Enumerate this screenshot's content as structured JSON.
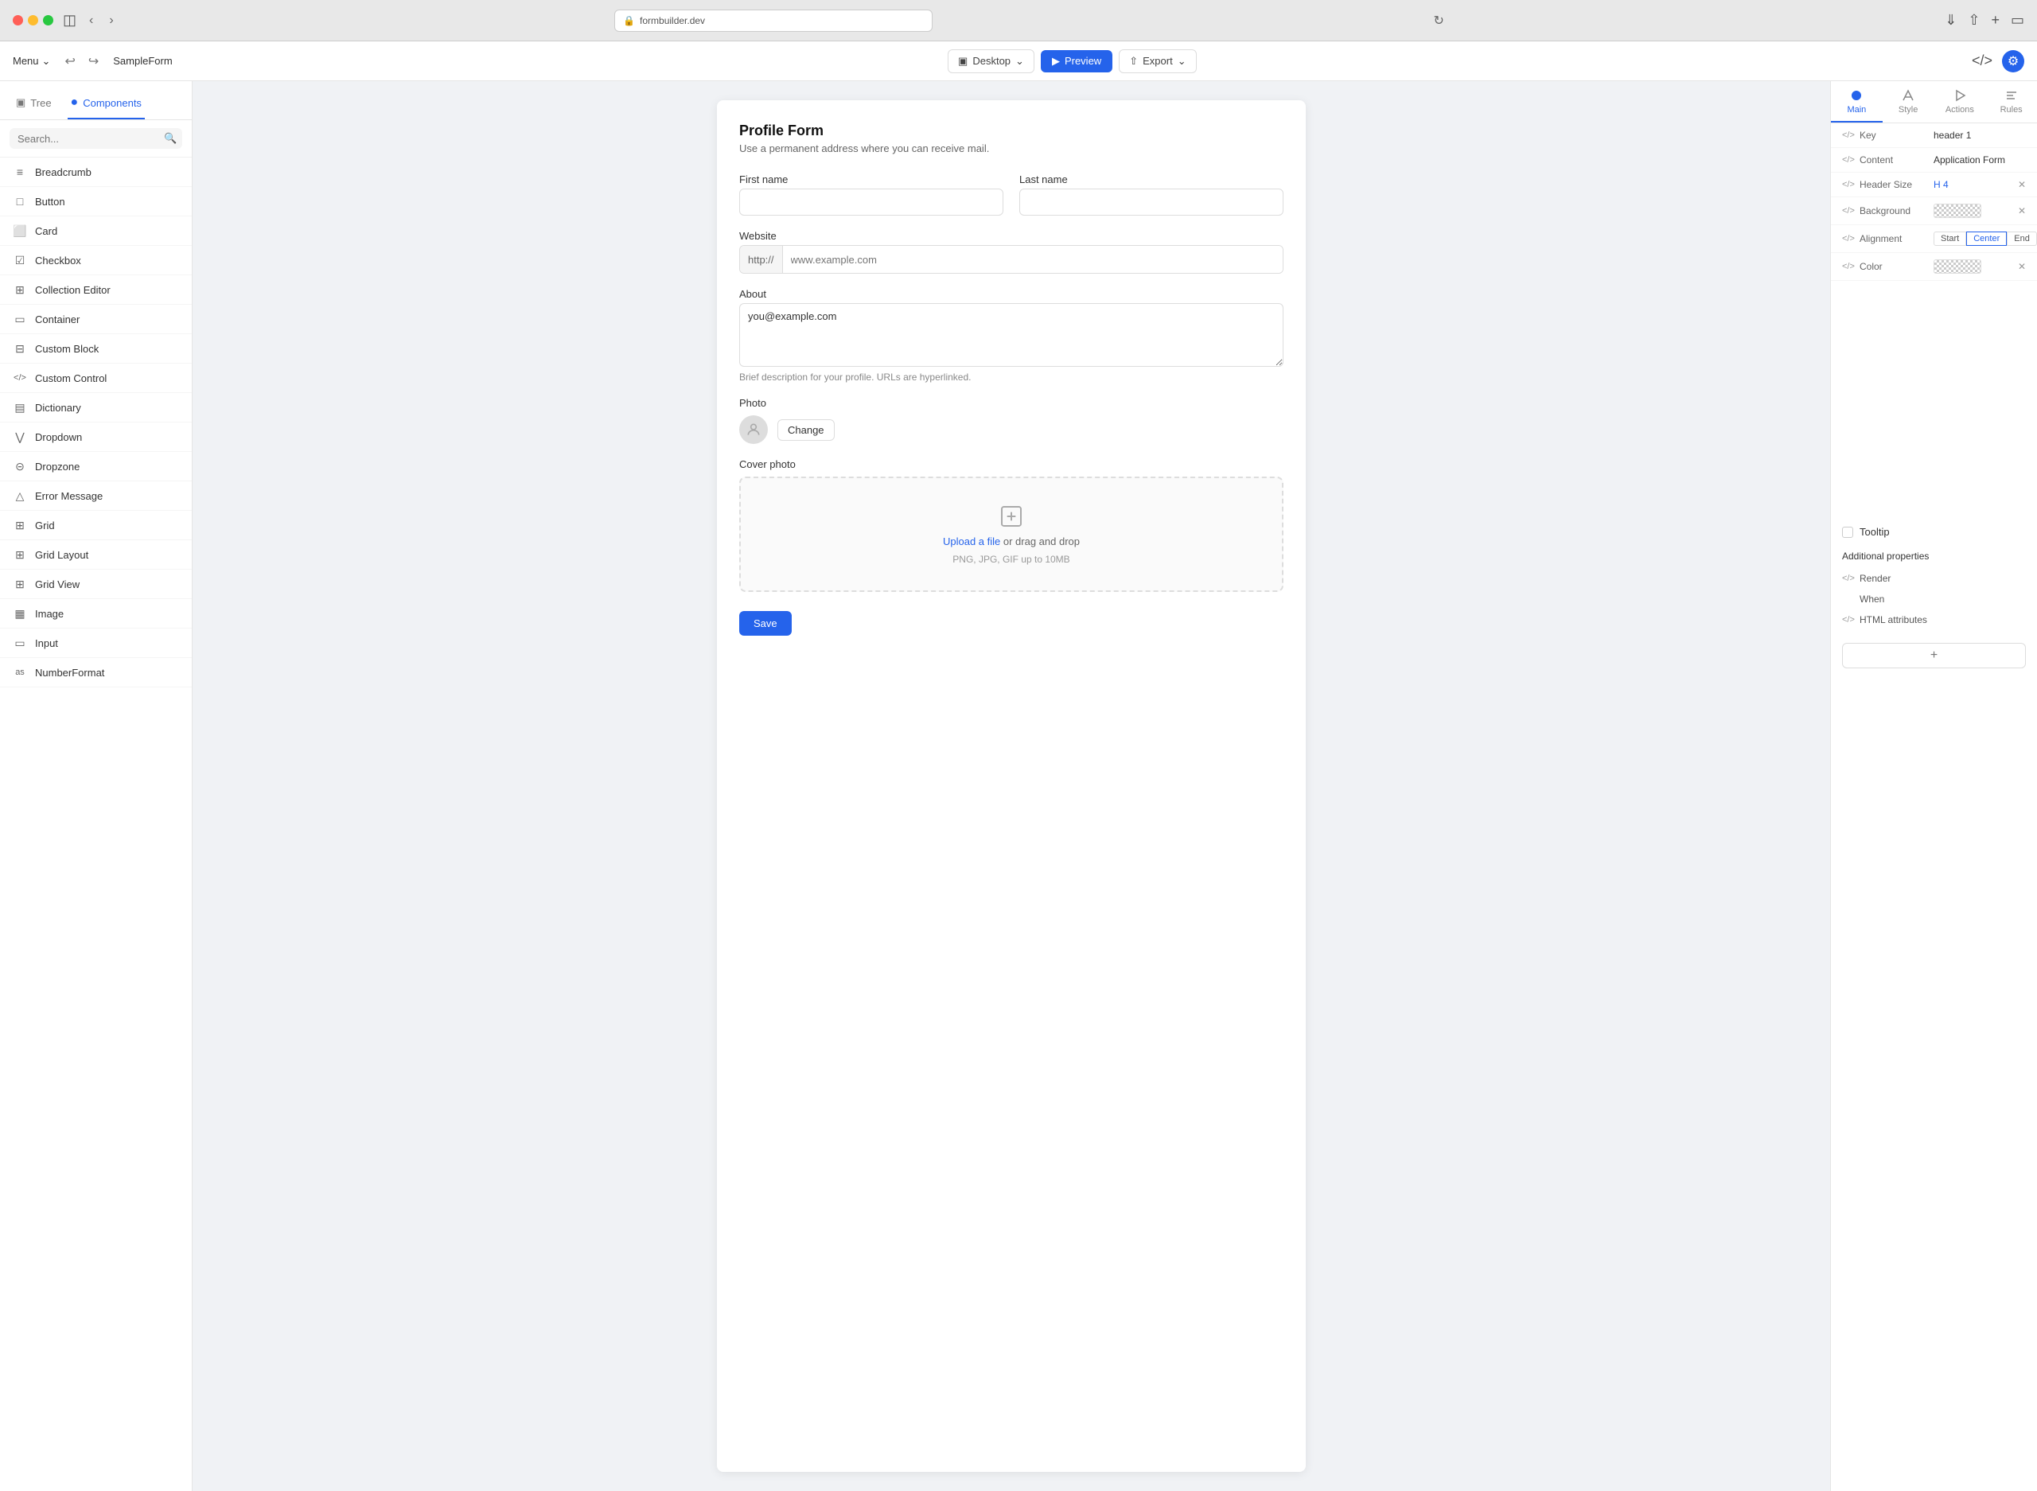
{
  "browser": {
    "url": "formbuilder.dev",
    "lock_icon": "🔒",
    "reload_icon": "↻"
  },
  "toolbar": {
    "menu_label": "Menu",
    "form_name": "SampleForm",
    "desktop_label": "Desktop",
    "preview_label": "Preview",
    "export_label": "Export"
  },
  "left_sidebar": {
    "tree_tab": "Tree",
    "components_tab": "Components",
    "search_placeholder": "Search...",
    "components": [
      {
        "name": "Breadcrumb",
        "icon": "≡"
      },
      {
        "name": "Button",
        "icon": "□"
      },
      {
        "name": "Card",
        "icon": "▭"
      },
      {
        "name": "Checkbox",
        "icon": "☑"
      },
      {
        "name": "Collection Editor",
        "icon": "⊞"
      },
      {
        "name": "Container",
        "icon": "◫"
      },
      {
        "name": "Custom Block",
        "icon": "⊡"
      },
      {
        "name": "Custom Control",
        "icon": "</>"
      },
      {
        "name": "Dictionary",
        "icon": "▤"
      },
      {
        "name": "Dropdown",
        "icon": "∨"
      },
      {
        "name": "Dropzone",
        "icon": "⊡"
      },
      {
        "name": "Error Message",
        "icon": "△"
      },
      {
        "name": "Grid",
        "icon": "⊞"
      },
      {
        "name": "Grid Layout",
        "icon": "⊞"
      },
      {
        "name": "Grid View",
        "icon": "⊞"
      },
      {
        "name": "Image",
        "icon": "🖼"
      },
      {
        "name": "Input",
        "icon": "▭"
      },
      {
        "name": "NumberFormat",
        "icon": "#"
      }
    ]
  },
  "form": {
    "title": "Profile Form",
    "subtitle": "Use a permanent address where you can receive mail.",
    "first_name_label": "First name",
    "last_name_label": "Last name",
    "website_label": "Website",
    "website_prefix": "http://",
    "website_placeholder": "www.example.com",
    "about_label": "About",
    "about_value": "you@example.com",
    "about_hint": "Brief description for your profile. URLs are hyperlinked.",
    "photo_label": "Photo",
    "change_btn": "Change",
    "cover_label": "Cover photo",
    "upload_link": "Upload a file",
    "upload_text": " or drag and drop",
    "upload_hint": "PNG, JPG, GIF up to 10MB",
    "save_btn": "Save"
  },
  "right_panel": {
    "tabs": [
      {
        "id": "main",
        "label": "Main"
      },
      {
        "id": "style",
        "label": "Style"
      },
      {
        "id": "actions",
        "label": "Actions"
      },
      {
        "id": "rules",
        "label": "Rules"
      }
    ],
    "key_label": "Key",
    "key_value": "header 1",
    "content_label": "Content",
    "content_value": "Application Form",
    "header_size_label": "Header Size",
    "header_size_value": "H 4",
    "background_label": "Background",
    "alignment_label": "Alignment",
    "alignment_start": "Start",
    "alignment_center": "Center",
    "alignment_end": "End",
    "color_label": "Color",
    "tooltip_label": "Tooltip",
    "additional_props_label": "Additional properties",
    "render_label": "Render",
    "when_label": "When",
    "html_attrs_label": "HTML attributes"
  }
}
